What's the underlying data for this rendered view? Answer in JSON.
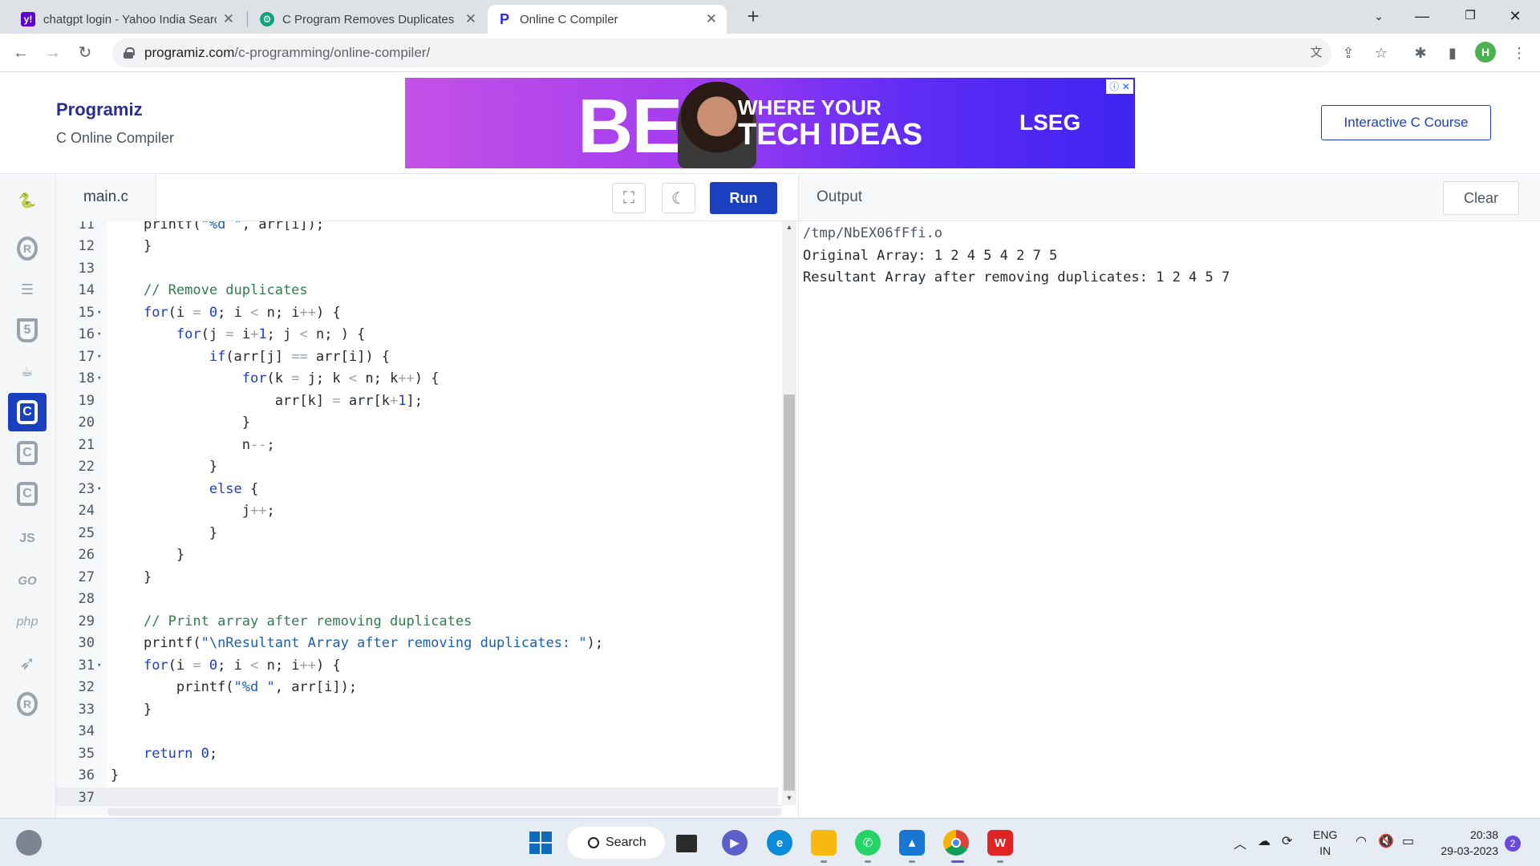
{
  "browser": {
    "tabs": [
      {
        "title": "chatgpt login - Yahoo India Searc",
        "icon": "yahoo-icon",
        "color": "#5f01d1"
      },
      {
        "title": "C Program Removes Duplicates",
        "icon": "chatgpt-icon",
        "color": "#10a37f"
      },
      {
        "title": "Online C Compiler",
        "icon": "programiz-icon",
        "color": "#2c2ee0"
      }
    ],
    "url_host": "programiz.com",
    "url_path": "/c-programming/online-compiler/",
    "profile_initial": "H"
  },
  "header": {
    "logo": "Programiz",
    "subtitle": "C Online Compiler",
    "course_button": "Interactive C Course",
    "ad": {
      "big": "BE",
      "line1": "WHERE YOUR",
      "line2": "TECH IDEAS",
      "brand": "LSEG"
    }
  },
  "sidebar": {
    "languages": [
      "python",
      "r",
      "sql",
      "html",
      "java",
      "c",
      "cplusplus",
      "csharp",
      "js",
      "go",
      "php",
      "swift",
      "rust"
    ],
    "active": "c",
    "labels": {
      "js": "JS",
      "go": "GO",
      "php": "php"
    }
  },
  "editor": {
    "filename": "main.c",
    "run_label": "Run",
    "lines": [
      {
        "n": "11",
        "html": "    <span>printf(</span><span class=\"st\">\"%d \"</span><span>, arr[i]);</span>",
        "fold": false
      },
      {
        "n": "12",
        "html": "    }",
        "fold": false
      },
      {
        "n": "13",
        "html": "",
        "fold": false
      },
      {
        "n": "14",
        "html": "    <span class=\"cm\">// Remove duplicates</span>",
        "fold": false
      },
      {
        "n": "15",
        "html": "    <span class=\"kw\">for</span>(i <span class=\"op\">=</span> <span class=\"nm\">0</span>; i <span class=\"op\">&lt;</span> n; i<span class=\"op\">++</span>) {",
        "fold": true
      },
      {
        "n": "16",
        "html": "        <span class=\"kw\">for</span>(j <span class=\"op\">=</span> i<span class=\"op\">+</span><span class=\"nm\">1</span>; j <span class=\"op\">&lt;</span> n; ) {",
        "fold": true
      },
      {
        "n": "17",
        "html": "            <span class=\"kw\">if</span>(arr[j] <span class=\"op\">==</span> arr[i]) {",
        "fold": true
      },
      {
        "n": "18",
        "html": "                <span class=\"kw\">for</span>(k <span class=\"op\">=</span> j; k <span class=\"op\">&lt;</span> n; k<span class=\"op\">++</span>) {",
        "fold": true
      },
      {
        "n": "19",
        "html": "                    arr[k] <span class=\"op\">=</span> arr[k<span class=\"op\">+</span><span class=\"nm\">1</span>];",
        "fold": false
      },
      {
        "n": "20",
        "html": "                }",
        "fold": false
      },
      {
        "n": "21",
        "html": "                n<span class=\"op\">--</span>;",
        "fold": false
      },
      {
        "n": "22",
        "html": "            }",
        "fold": false
      },
      {
        "n": "23",
        "html": "            <span class=\"kw\">else</span> {",
        "fold": true
      },
      {
        "n": "24",
        "html": "                j<span class=\"op\">++</span>;",
        "fold": false
      },
      {
        "n": "25",
        "html": "            }",
        "fold": false
      },
      {
        "n": "26",
        "html": "        }",
        "fold": false
      },
      {
        "n": "27",
        "html": "    }",
        "fold": false
      },
      {
        "n": "28",
        "html": "",
        "fold": false
      },
      {
        "n": "29",
        "html": "    <span class=\"cm\">// Print array after removing duplicates</span>",
        "fold": false
      },
      {
        "n": "30",
        "html": "    printf(<span class=\"st\">\"\\nResultant Array after removing duplicates: \"</span>);",
        "fold": false
      },
      {
        "n": "31",
        "html": "    <span class=\"kw\">for</span>(i <span class=\"op\">=</span> <span class=\"nm\">0</span>; i <span class=\"op\">&lt;</span> n; i<span class=\"op\">++</span>) {",
        "fold": true
      },
      {
        "n": "32",
        "html": "        printf(<span class=\"st\">\"%d \"</span>, arr[i]);",
        "fold": false
      },
      {
        "n": "33",
        "html": "    }",
        "fold": false
      },
      {
        "n": "34",
        "html": "",
        "fold": false
      },
      {
        "n": "35",
        "html": "    <span class=\"kw\">return</span> <span class=\"nm\">0</span>;",
        "fold": false
      },
      {
        "n": "36",
        "html": "}",
        "fold": false
      },
      {
        "n": "37",
        "html": "",
        "fold": false,
        "current": true
      }
    ]
  },
  "output": {
    "label": "Output",
    "clear_label": "Clear",
    "lines": [
      "/tmp/NbEX06fFfi.o",
      "Original Array: 1 2 4 5 4 2 7 5",
      "Resultant Array after removing duplicates: 1 2 4 5 7"
    ]
  },
  "taskbar": {
    "search_label": "Search",
    "lang_line1": "ENG",
    "lang_line2": "IN",
    "time": "20:38",
    "date": "29-03-2023",
    "notifications": "2"
  }
}
